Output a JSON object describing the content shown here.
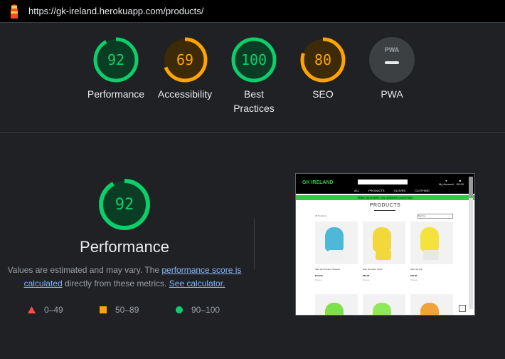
{
  "topbar": {
    "url": "https://gk-ireland.herokuapp.com/products/"
  },
  "colors": {
    "pass": "#0cce6b",
    "average": "#ffa400",
    "fail": "#ff4e42",
    "pwa": "#9aa0a6",
    "track_pass": "#0b3d24",
    "track_average": "#3d2a08"
  },
  "gauges": [
    {
      "label": "Performance",
      "score": "92",
      "level": 0.92,
      "status": "pass"
    },
    {
      "label": "Accessibility",
      "score": "69",
      "level": 0.69,
      "status": "average"
    },
    {
      "label": "Best Practices",
      "score": "100",
      "level": 1.0,
      "status": "pass"
    },
    {
      "label": "SEO",
      "score": "80",
      "level": 0.8,
      "status": "average"
    },
    {
      "label": "PWA",
      "icon": "pwa-icon",
      "badge": "PWA"
    }
  ],
  "performance": {
    "score": "92",
    "level": 0.92,
    "title": "Performance",
    "desc_prefix": "Values are estimated and may vary. The ",
    "link_score": "performance score is calculated",
    "desc_mid": " directly from these metrics. ",
    "link_calc": "See calculator."
  },
  "legend": [
    {
      "shape": "triangle",
      "range": "0–49"
    },
    {
      "shape": "square",
      "range": "50–89"
    },
    {
      "shape": "circle",
      "range": "90–100"
    }
  ],
  "screenshot": {
    "brand": "GK IRELAND",
    "nav": "ALL PRODUCTS GLOVES CLOTHING",
    "account": "My Account",
    "bag": "€0.00",
    "banner": "FREE DELIVERY ON ORDERS OVER €50!",
    "heading": "PRODUCTS",
    "count": "25 Products",
    "sort": "Sort by...",
    "products": [
      {
        "name": "Nike Gk Phantom Shadow",
        "price": "€115.00",
        "cat": "Gloves",
        "palm": "#4fb8d8",
        "cuff": "#f0f0f0"
      },
      {
        "name": "Nike Gk Vapor Grip3",
        "price": "€60.00",
        "cat": "Gloves",
        "palm": "#f2d83a",
        "cuff": "#f2d83a"
      },
      {
        "name": "Nike Gk Grip",
        "price": "€50.00",
        "cat": "Gloves",
        "palm": "#f4e33c",
        "cuff": "#e8e8e8"
      }
    ],
    "row2": [
      {
        "palm": "#7fe04c"
      },
      {
        "palm": "#8fe85a"
      },
      {
        "palm": "#f2a23a"
      }
    ],
    "top_btn": "↑"
  }
}
